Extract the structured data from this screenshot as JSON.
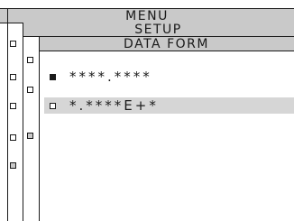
{
  "header": {
    "menu_title": "MENU",
    "setup_title": "SETUP",
    "page_title": "DATA FORM"
  },
  "options": [
    {
      "label": "****.****",
      "selected": true
    },
    {
      "label": "*.****E+*",
      "selected": false
    }
  ],
  "colors": {
    "bar_bg": "#c9c9c9",
    "highlight_bg": "#d6d6d6",
    "ink": "#1a1a1a"
  }
}
